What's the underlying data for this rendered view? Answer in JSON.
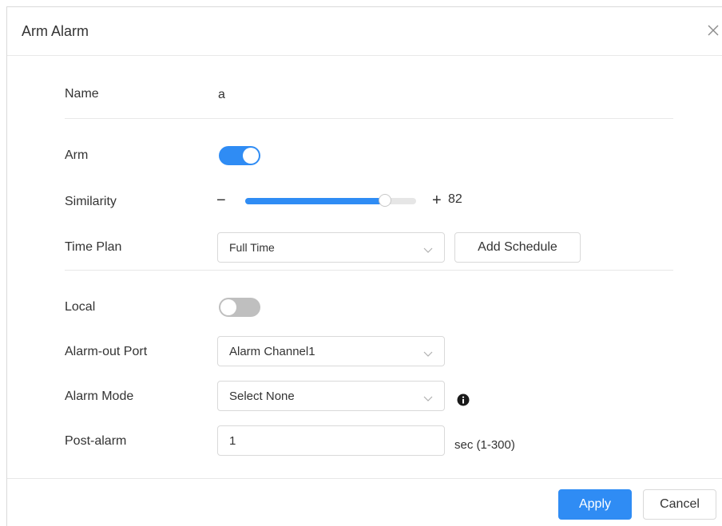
{
  "dialog": {
    "title": "Arm Alarm",
    "close_icon": "close-icon"
  },
  "form": {
    "name": {
      "label": "Name",
      "value": "a"
    },
    "arm": {
      "label": "Arm",
      "on": true
    },
    "similarity": {
      "label": "Similarity",
      "minus": "−",
      "plus": "+",
      "value": "82",
      "fraction": 0.82
    },
    "time_plan": {
      "label": "Time Plan",
      "selected": "Full Time",
      "add_schedule_label": "Add Schedule"
    },
    "local": {
      "label": "Local",
      "on": false
    },
    "alarm_out_port": {
      "label": "Alarm-out Port",
      "selected": "Alarm Channel1"
    },
    "alarm_mode": {
      "label": "Alarm Mode",
      "selected": "Select None",
      "info_icon": "info-icon"
    },
    "post_alarm": {
      "label": "Post-alarm",
      "value": "1",
      "unit": "sec (1-300)"
    }
  },
  "footer": {
    "apply_label": "Apply",
    "cancel_label": "Cancel"
  },
  "colors": {
    "accent": "#2f8cf4",
    "toggle_off": "#bfbfbf",
    "border": "#d9d9d9",
    "text": "#333333"
  }
}
